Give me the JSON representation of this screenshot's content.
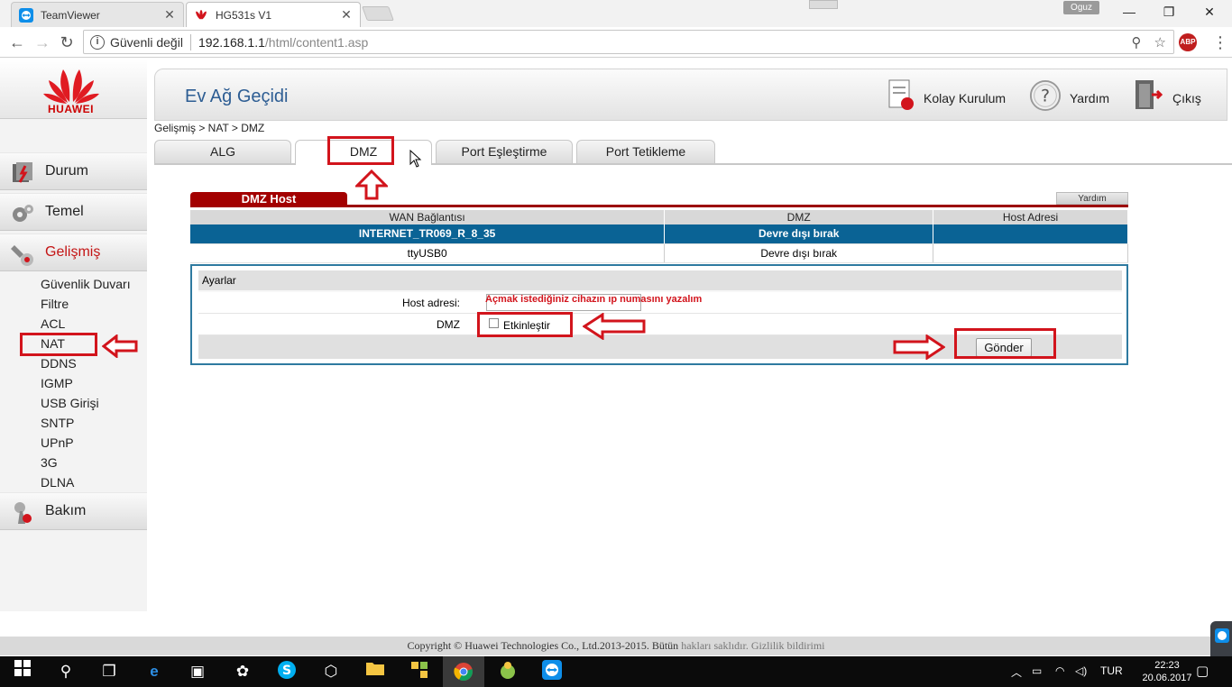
{
  "browser": {
    "tabs": [
      {
        "title": "TeamViewer",
        "close": "✕"
      },
      {
        "title": "HG531s V1",
        "close": "✕"
      }
    ],
    "profile": "Oguz",
    "window_controls": [
      "—",
      "❐",
      "✕"
    ],
    "security_text": "Güvenli değil",
    "url_host": "192.168.1.1",
    "url_path": "/html/content1.asp",
    "abp_label": "ABP"
  },
  "page": {
    "logo_text": "HUAWEI",
    "title": "Ev Ağ Geçidi",
    "header_links": {
      "setup": "Kolay Kurulum",
      "help": "Yardım",
      "exit": "Çıkış"
    },
    "breadcrumb": "Gelişmiş > NAT > DMZ",
    "tabs": [
      "ALG",
      "DMZ",
      "Port Eşleştirme",
      "Port Tetikleme"
    ],
    "active_tab": "DMZ"
  },
  "sidebar": {
    "main": [
      {
        "label": "Durum",
        "icon": "status-icon"
      },
      {
        "label": "Temel",
        "icon": "gear-icon"
      },
      {
        "label": "Gelişmiş",
        "icon": "advanced-icon"
      },
      {
        "label": "Bakım",
        "icon": "maintenance-icon"
      }
    ],
    "sub": [
      "Güvenlik Duvarı",
      "Filtre",
      "ACL",
      "NAT",
      "DDNS",
      "IGMP",
      "USB Girişi",
      "SNTP",
      "UPnP",
      "3G",
      "DLNA"
    ],
    "active_sub": "NAT"
  },
  "panel": {
    "title": "DMZ Host",
    "help": "Yardım",
    "table": {
      "headers": [
        "WAN Bağlantısı",
        "DMZ",
        "Host Adresi"
      ],
      "rows": [
        [
          "INTERNET_TR069_R_8_35",
          "Devre dışı bırak",
          ""
        ],
        [
          "ttyUSB0",
          "Devre dışı bırak",
          ""
        ]
      ]
    },
    "settings": {
      "title": "Ayarlar",
      "host_label": "Host adresi:",
      "host_value": "",
      "dmz_label": "DMZ",
      "enable_label": "Etkinleştir",
      "enable_checked": false,
      "submit": "Gönder"
    },
    "annotation": "Açmak istediğiniz cihazın ıp numasını yazalım"
  },
  "footer": {
    "copyright": "Copyright © Huawei Technologies Co., Ltd.2013-2015. Bütün ",
    "rights": "hakları saklıdır.",
    "privacy": "Gizlilik bildirimi"
  },
  "taskbar": {
    "lang": "TUR",
    "time": "22:23",
    "date": "20.06.2017"
  },
  "colors": {
    "accent_red": "#d2141c",
    "huawei_red": "#c00000",
    "selected_row": "#0a6395",
    "title_blue": "#2d5d93"
  }
}
